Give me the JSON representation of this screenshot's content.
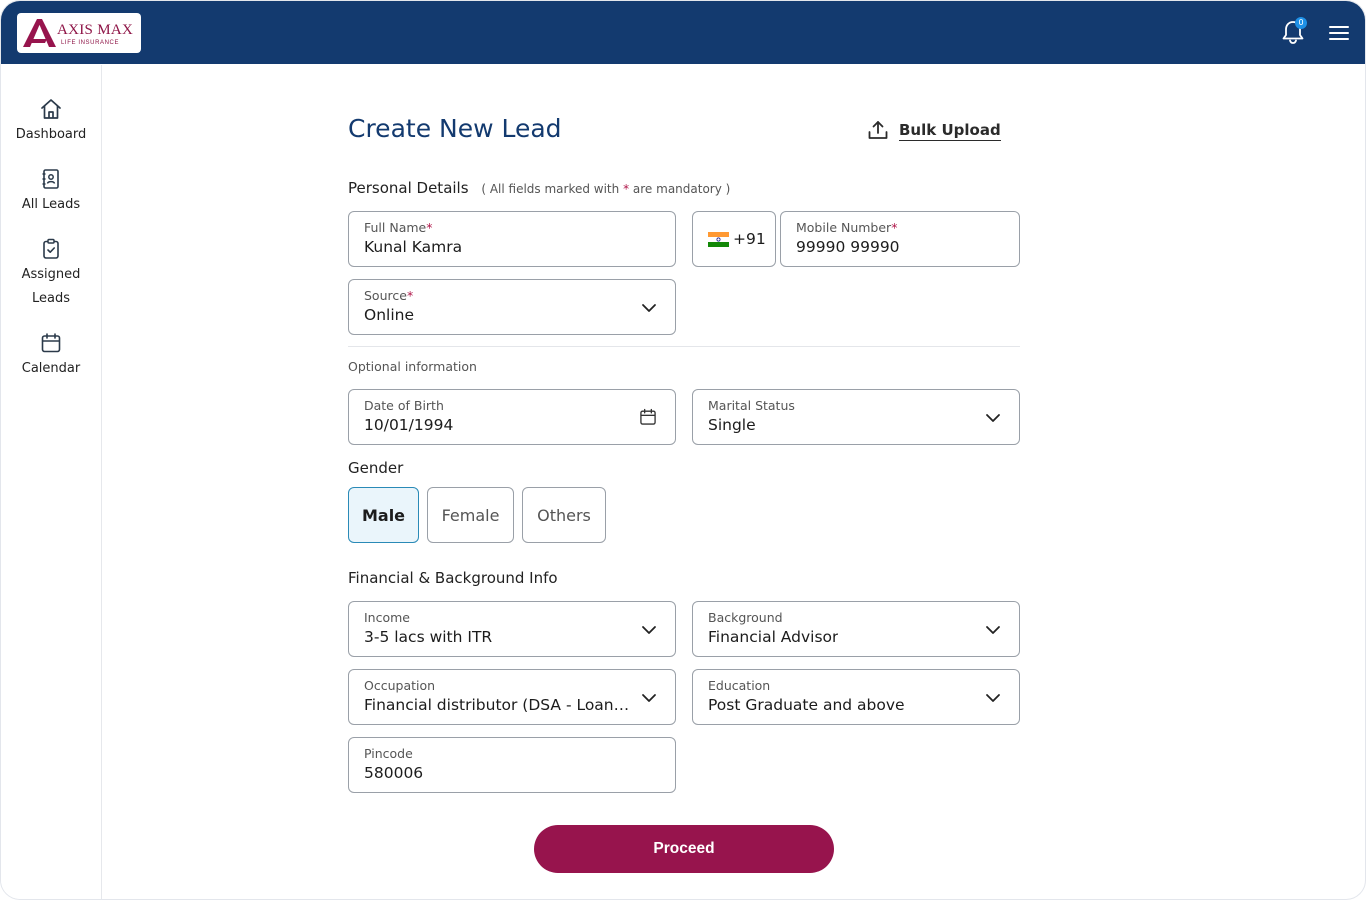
{
  "header": {
    "logo_brand": "AXIS MAX",
    "logo_sub": "LIFE INSURANCE",
    "notification_count": "0",
    "icons": {
      "bell": "bell-icon",
      "menu": "hamburger-menu-icon"
    },
    "bg_color": "#133a6f"
  },
  "sidebar": {
    "items": [
      {
        "label": "Dashboard",
        "icon": "home-icon"
      },
      {
        "label": "All Leads",
        "icon": "contacts-book-icon"
      },
      {
        "label": "Assigned",
        "label2": "Leads",
        "icon": "clipboard-check-icon"
      },
      {
        "label": "Calendar",
        "icon": "calendar-icon"
      }
    ]
  },
  "main": {
    "title": "Create New Lead",
    "bulk_upload_label": "Bulk Upload",
    "personal": {
      "heading": "Personal Details",
      "note_prefix": "( All fields marked with",
      "note_star": "*",
      "note_suffix": "are mandatory )",
      "full_name": {
        "label": "Full Name",
        "required": "*",
        "value": "Kunal Kamra"
      },
      "country_code": "+91",
      "mobile": {
        "label": "Mobile Number",
        "required": "*",
        "value": "99990 99990"
      },
      "source": {
        "label": "Source",
        "required": "*",
        "value": "Online"
      }
    },
    "optional": {
      "heading": "Optional information",
      "dob": {
        "label": "Date of Birth",
        "value": "10/01/1994"
      },
      "marital": {
        "label": "Marital Status",
        "value": "Single"
      },
      "gender_heading": "Gender",
      "gender_options": [
        "Male",
        "Female",
        "Others"
      ],
      "gender_selected": "Male"
    },
    "financial": {
      "heading": "Financial & Background Info",
      "income": {
        "label": "Income",
        "value": "3-5 lacs with ITR"
      },
      "background": {
        "label": "Background",
        "value": "Financial Advisor"
      },
      "occupation": {
        "label": "Occupation",
        "value": "Financial distributor (DSA - Loans/Credit Cards)"
      },
      "education": {
        "label": "Education",
        "value": "Post Graduate and above"
      },
      "pincode": {
        "label": "Pincode",
        "value": "580006"
      }
    },
    "proceed_label": "Proceed"
  },
  "colors": {
    "primary_navy": "#133a6f",
    "accent_burgundy": "#97144d",
    "selected_chip_bg": "#eaf5fb",
    "selected_chip_border": "#2a8ab7"
  }
}
